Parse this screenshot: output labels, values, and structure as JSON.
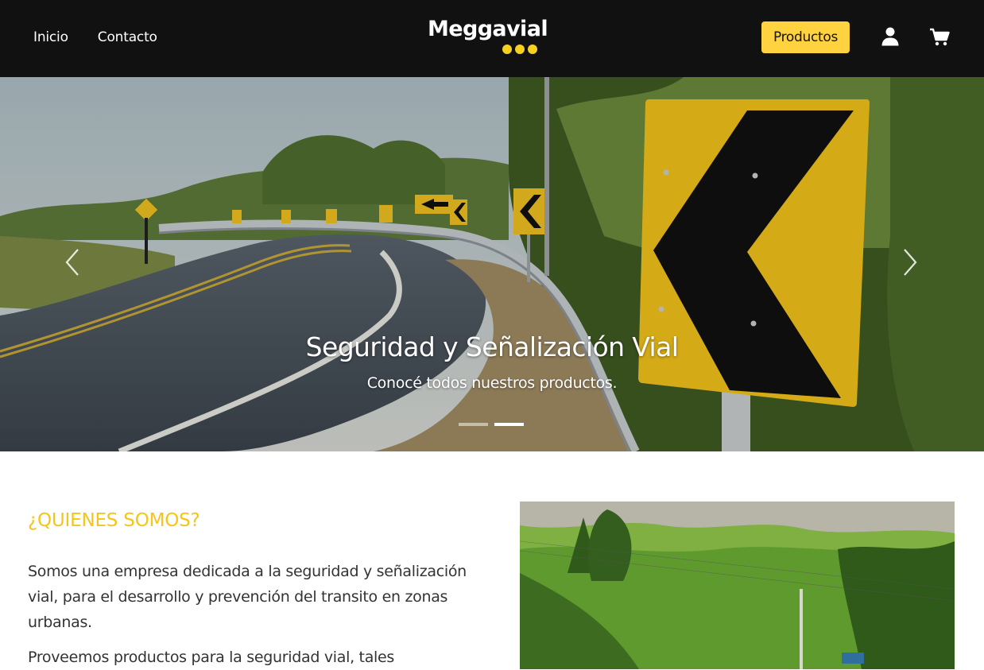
{
  "nav": {
    "links": [
      "Inicio",
      "Contacto"
    ],
    "logo_text": "Meggavial",
    "productos_label": "Productos",
    "user_icon": "user-icon",
    "cart_icon": "cart-icon"
  },
  "hero": {
    "title": "Seguridad y Señalización Vial",
    "subtitle": "Conocé todos nuestros productos.",
    "slides_total": 2,
    "active_slide": 2,
    "prev_icon": "chevron-left-icon",
    "next_icon": "chevron-right-icon"
  },
  "about": {
    "heading": "¿QUIENES SOMOS?",
    "paragraph_1": "Somos una empresa dedicada a la seguridad y señalización vial, para el desarrollo y prevención del transito en zonas urbanas.",
    "paragraph_2": "Proveemos productos para la seguridad vial, tales"
  },
  "colors": {
    "navbar_bg": "#111111",
    "accent_yellow": "#ffd23f",
    "heading_yellow": "#f5c518",
    "text": "#333333"
  }
}
